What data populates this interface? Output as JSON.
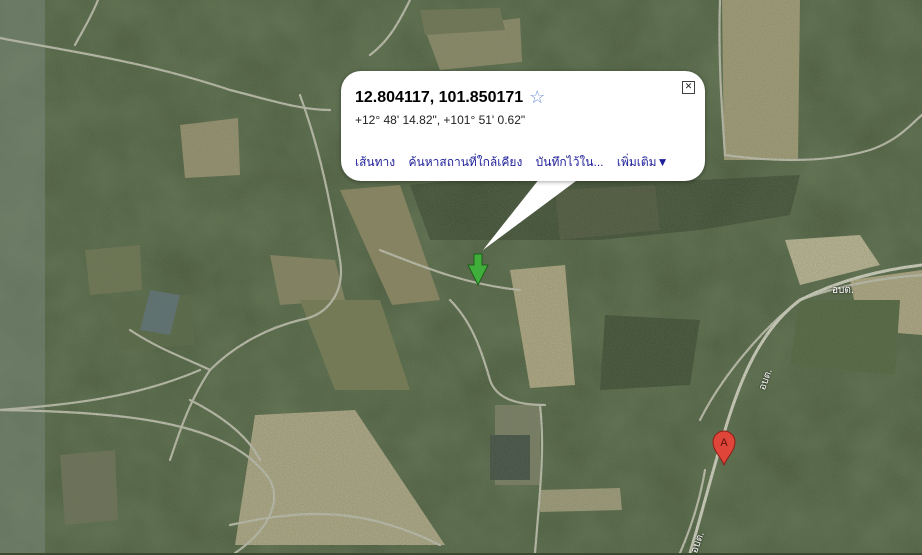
{
  "popup": {
    "coords": "12.804117, 101.850171",
    "dms": "+12° 48' 14.82\", +101° 51' 0.62\"",
    "star_icon": "star-icon",
    "close_icon": "close-icon",
    "links": {
      "directions": "เส้นทาง",
      "search_nearby": "ค้นหาสถานที่ใกล้เคียง",
      "save_to": "บันทึกไว้ใน...",
      "more": "เพิ่มเติม▼"
    }
  },
  "markers": {
    "location_arrow": "green-arrow-marker-icon",
    "pin_a": {
      "label": "A",
      "color": "#e0453a"
    }
  },
  "map": {
    "type": "satellite",
    "road_labels": [
      "อบต.",
      "อบต.",
      "อบต."
    ]
  }
}
